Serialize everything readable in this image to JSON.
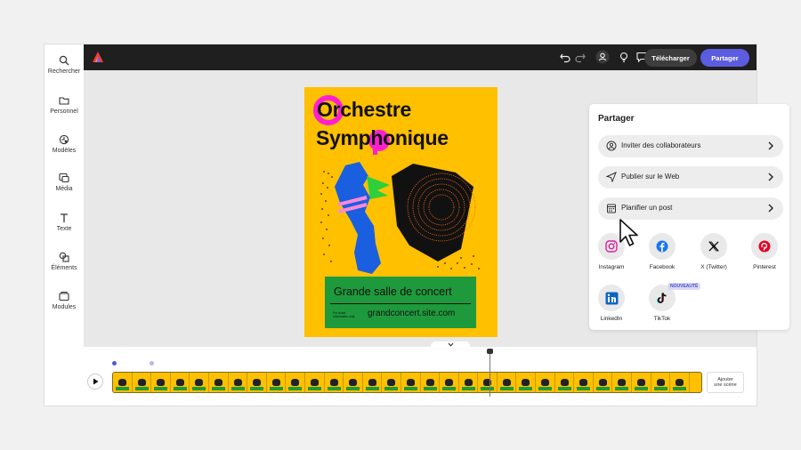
{
  "sidebar": {
    "items": [
      {
        "label": "Rechercher",
        "icon": "search-icon"
      },
      {
        "label": "Personnel",
        "icon": "folder-icon"
      },
      {
        "label": "Modèles",
        "icon": "templates-icon"
      },
      {
        "label": "Média",
        "icon": "media-icon"
      },
      {
        "label": "Texte",
        "icon": "text-icon"
      },
      {
        "label": "Éléments",
        "icon": "elements-icon"
      },
      {
        "label": "Modules",
        "icon": "modules-icon"
      }
    ]
  },
  "topbar": {
    "download_label": "Télécharger",
    "share_label": "Partager",
    "icons": [
      "undo-icon",
      "redo-icon",
      "user-icon",
      "lightbulb-icon",
      "comment-icon",
      "copy-icon",
      "more-icon"
    ]
  },
  "poster": {
    "title_line1": "Orchestre",
    "title_line2": "Symphonique",
    "venue": "Grande salle de concert",
    "small_text": "For ticket information visit",
    "site": "grandconcert.site.com"
  },
  "share_panel": {
    "title": "Partager",
    "rows": [
      {
        "label": "Inviter des collaborateurs",
        "icon": "invite-icon"
      },
      {
        "label": "Publier sur le Web",
        "icon": "send-icon"
      },
      {
        "label": "Planifier un post",
        "icon": "calendar-icon"
      }
    ],
    "socials": [
      {
        "label": "Instagram",
        "icon": "instagram-icon"
      },
      {
        "label": "Facebook",
        "icon": "facebook-icon"
      },
      {
        "label": "X (Twitter)",
        "icon": "x-twitter-icon"
      },
      {
        "label": "Pinterest",
        "icon": "pinterest-icon"
      },
      {
        "label": "LinkedIn",
        "icon": "linkedin-icon"
      },
      {
        "label": "TikTok",
        "icon": "tiktok-icon"
      }
    ],
    "badge": "NOUVEAUTÉ"
  },
  "timeline": {
    "add_scene_line1": "Ajouter",
    "add_scene_line2": "une scène"
  },
  "colors": {
    "accent": "#5c5ce0",
    "poster_bg": "#ffc000",
    "poster_green": "#1e9a3c",
    "magenta": "#ff1fd0",
    "topbar": "#1f1f1f"
  }
}
